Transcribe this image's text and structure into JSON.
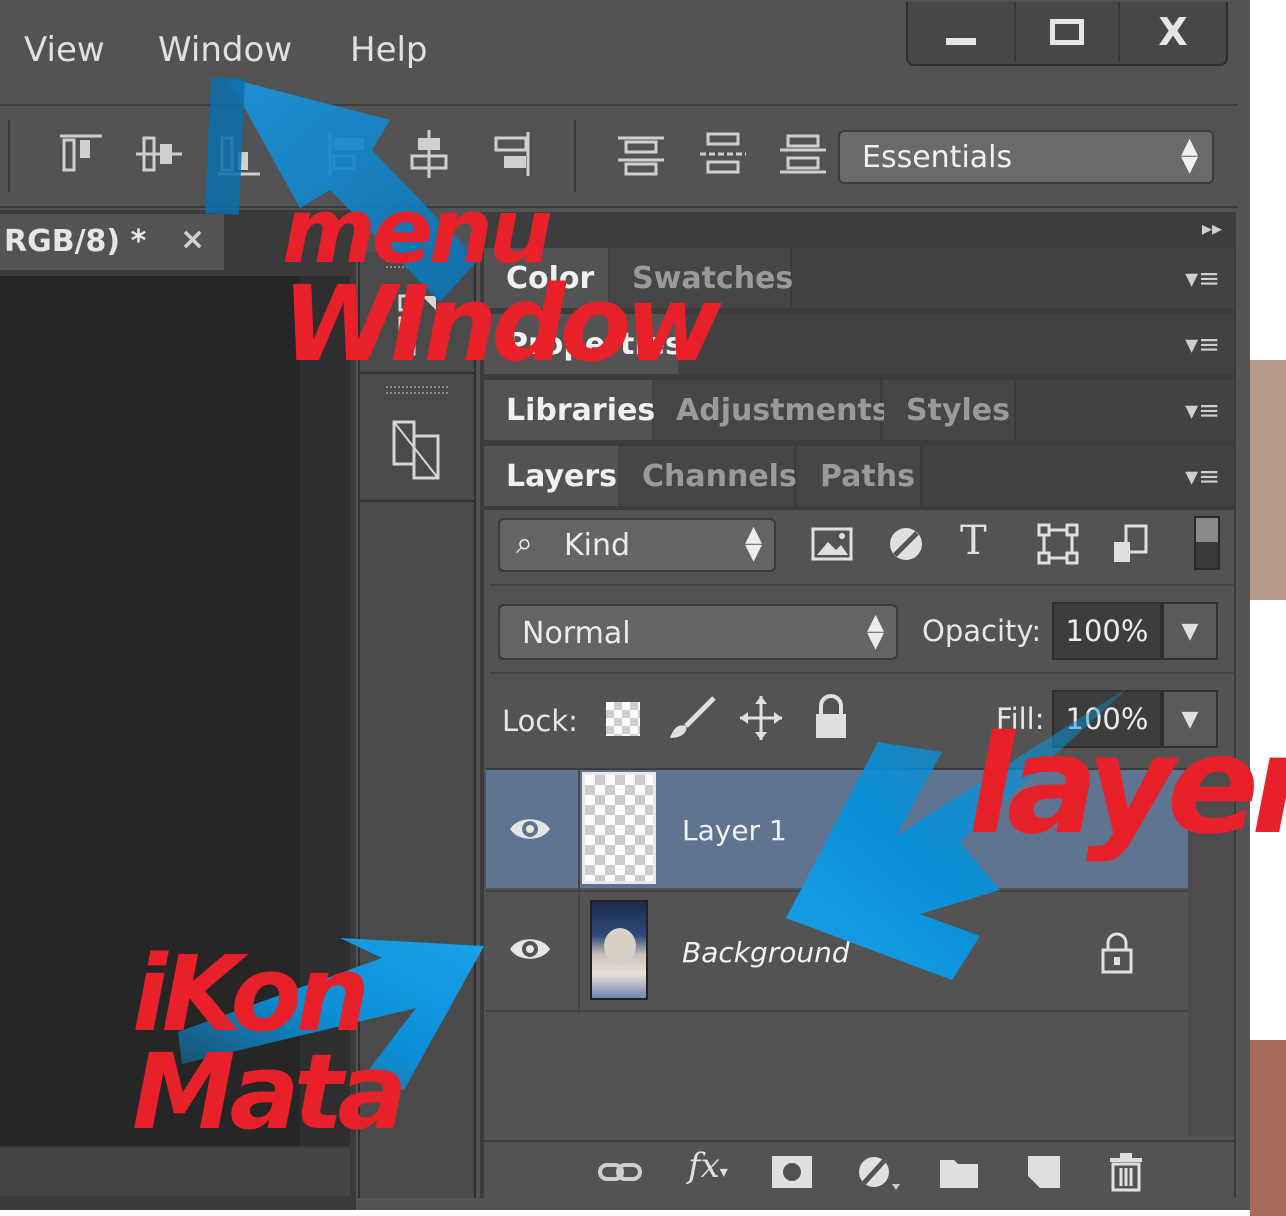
{
  "menu": {
    "items": [
      "View",
      "Window",
      "Help"
    ]
  },
  "window_controls": {
    "minimize": "—",
    "maximize": "□",
    "close": "X"
  },
  "workspace": {
    "selected": "Essentials"
  },
  "document": {
    "tab_title": "RGB/8) *",
    "tab_close": "×"
  },
  "panels": {
    "collapse_icon": "▸▸",
    "group1": {
      "tabs": [
        "Color",
        "Swatches"
      ]
    },
    "group2": {
      "tabs": [
        "Properties"
      ]
    },
    "group3": {
      "tabs": [
        "Libraries",
        "Adjustments",
        "Styles"
      ]
    },
    "group4": {
      "tabs": [
        "Layers",
        "Channels",
        "Paths"
      ]
    },
    "menu_icon": "▾≡"
  },
  "layers_panel": {
    "filter": {
      "label": "Kind"
    },
    "blend_mode": "Normal",
    "opacity_label": "Opacity:",
    "opacity_value": "100%",
    "lock_label": "Lock:",
    "fill_label": "Fill:",
    "fill_value": "100%",
    "layers": [
      {
        "name": "Layer 1",
        "visible": true,
        "selected": true,
        "locked": false
      },
      {
        "name": "Background",
        "visible": true,
        "selected": false,
        "locked": true
      }
    ]
  },
  "annotations": {
    "menu_window": [
      "menu",
      "WIndow"
    ],
    "layer": "layer",
    "ikon_mata": [
      "iKon",
      "Mata"
    ],
    "arrow_color": "#0a8fd6",
    "text_color": "#e8202a"
  }
}
